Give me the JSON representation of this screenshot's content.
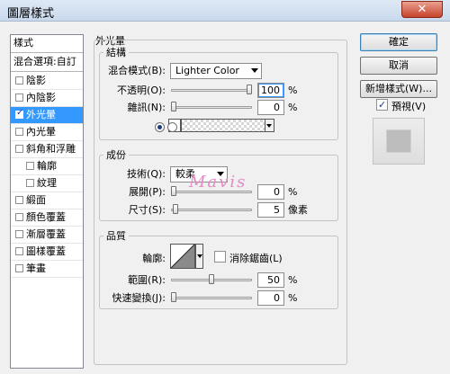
{
  "window": {
    "title": "圖層樣式",
    "close_label": "✕"
  },
  "style_list": {
    "header": "樣式",
    "blending_options": "混合選項:自訂",
    "items": [
      {
        "label": "陰影",
        "checked": false,
        "selected": false,
        "sub": false
      },
      {
        "label": "內陰影",
        "checked": false,
        "selected": false,
        "sub": false
      },
      {
        "label": "外光暈",
        "checked": true,
        "selected": true,
        "sub": false
      },
      {
        "label": "內光暈",
        "checked": false,
        "selected": false,
        "sub": false
      },
      {
        "label": "斜角和浮雕",
        "checked": false,
        "selected": false,
        "sub": false
      },
      {
        "label": "輪廓",
        "checked": false,
        "selected": false,
        "sub": true
      },
      {
        "label": "紋理",
        "checked": false,
        "selected": false,
        "sub": true
      },
      {
        "label": "緞面",
        "checked": false,
        "selected": false,
        "sub": false
      },
      {
        "label": "顏色覆蓋",
        "checked": false,
        "selected": false,
        "sub": false
      },
      {
        "label": "漸層覆蓋",
        "checked": false,
        "selected": false,
        "sub": false
      },
      {
        "label": "圖樣覆蓋",
        "checked": false,
        "selected": false,
        "sub": false
      },
      {
        "label": "筆畫",
        "checked": false,
        "selected": false,
        "sub": false
      }
    ]
  },
  "panel": {
    "title": "外光暈"
  },
  "structure": {
    "title": "結構",
    "blend_mode_label": "混合模式(B):",
    "blend_mode_value": "Lighter Color",
    "opacity_label": "不透明(O):",
    "opacity_value": "100",
    "opacity_level": 1.0,
    "noise_label": "雜訊(N):",
    "noise_value": "0",
    "noise_level": 0.0,
    "unit": "%",
    "swatch_color": "#ffffff"
  },
  "elements": {
    "title": "成份",
    "technique_label": "技術(Q):",
    "technique_value": "較柔",
    "spread_label": "展開(P):",
    "spread_value": "0",
    "spread_level": 0.0,
    "size_label": "尺寸(S):",
    "size_value": "5",
    "size_level": 0.02,
    "spread_unit": "%",
    "size_unit": "像素"
  },
  "quality": {
    "title": "品質",
    "contour_label": "輪廓:",
    "antialias_label": "消除鋸齒(L)",
    "antialias_checked": false,
    "range_label": "範圍(R):",
    "range_value": "50",
    "range_level": 0.5,
    "jitter_label": "快速變換(J):",
    "jitter_value": "0",
    "jitter_level": 0.0,
    "unit": "%"
  },
  "buttons": {
    "ok": "確定",
    "cancel": "取消",
    "new_style": "新增樣式(W)...",
    "preview_label": "預視(V)",
    "preview_checked": true
  },
  "watermark": "Mavis",
  "colors": {
    "selection": "#3399ff",
    "watermark": "#e58ac3"
  }
}
